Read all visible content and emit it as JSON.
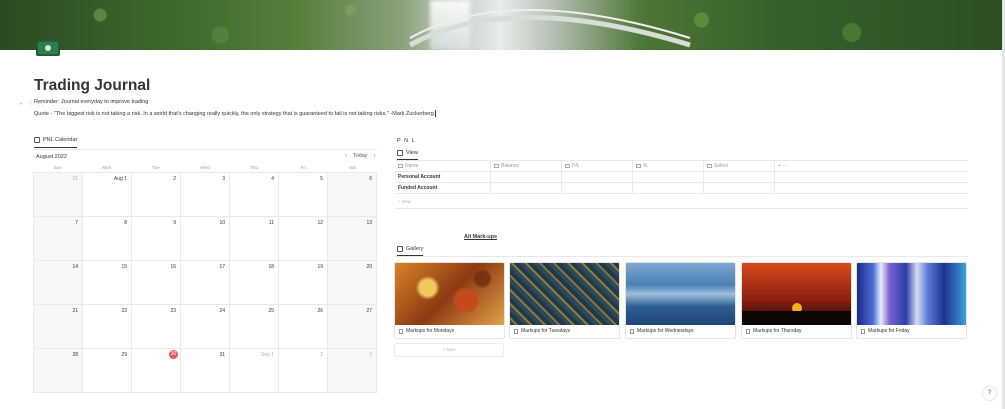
{
  "page": {
    "title": "Trading Journal",
    "reminder": "Reminder: Journal everyday to improve trading",
    "quote": "Quote - \"The biggest risk is not taking a risk. In a world that's changing really quickly, the only strategy that is guaranteed to fail is not taking risks.\" -Mark Zuckerberg"
  },
  "calendar": {
    "tab_label": "PNL Calendar",
    "month": "August 2022",
    "today_label": "Today",
    "prev_icon": "‹",
    "next_icon": "›",
    "weekdays": [
      "Sun",
      "Mon",
      "Tue",
      "Wed",
      "Thu",
      "Fri",
      "Sat"
    ],
    "days": [
      {
        "n": "31",
        "muted": true
      },
      {
        "n": "Aug 1"
      },
      {
        "n": "2"
      },
      {
        "n": "3"
      },
      {
        "n": "4"
      },
      {
        "n": "5"
      },
      {
        "n": "6"
      },
      {
        "n": "7"
      },
      {
        "n": "8"
      },
      {
        "n": "9"
      },
      {
        "n": "10"
      },
      {
        "n": "11"
      },
      {
        "n": "12"
      },
      {
        "n": "13"
      },
      {
        "n": "14"
      },
      {
        "n": "15"
      },
      {
        "n": "16"
      },
      {
        "n": "17"
      },
      {
        "n": "18"
      },
      {
        "n": "19"
      },
      {
        "n": "20"
      },
      {
        "n": "21"
      },
      {
        "n": "22"
      },
      {
        "n": "23"
      },
      {
        "n": "24"
      },
      {
        "n": "25"
      },
      {
        "n": "26"
      },
      {
        "n": "27"
      },
      {
        "n": "28"
      },
      {
        "n": "29"
      },
      {
        "n": "30",
        "today": true
      },
      {
        "n": "31"
      },
      {
        "n": "Sep 1",
        "muted": true
      },
      {
        "n": "2",
        "muted": true
      },
      {
        "n": "3",
        "muted": true
      }
    ]
  },
  "pnl": {
    "title": "P N L",
    "tab_label": "View",
    "columns": [
      "Name",
      "Balance",
      "P/L",
      "%",
      "Select",
      "+  ···"
    ],
    "rows": [
      "Personal Account",
      "Funded Account"
    ],
    "new_label": "+ New"
  },
  "gallery": {
    "link_label": "All Mark-ups",
    "tab_label": "Gallery",
    "cards": [
      "Markups for Mondays",
      "Markups for Tuesdays",
      "Markups for Wednesdays",
      "Markups for Thursday",
      "Markups for Friday"
    ],
    "new_label": "+ New"
  },
  "help_label": "?",
  "colors": {
    "today": "#eb5757",
    "text": "#37352f",
    "muted": "#9b9a97",
    "page_icon": "#2e7d4f"
  }
}
